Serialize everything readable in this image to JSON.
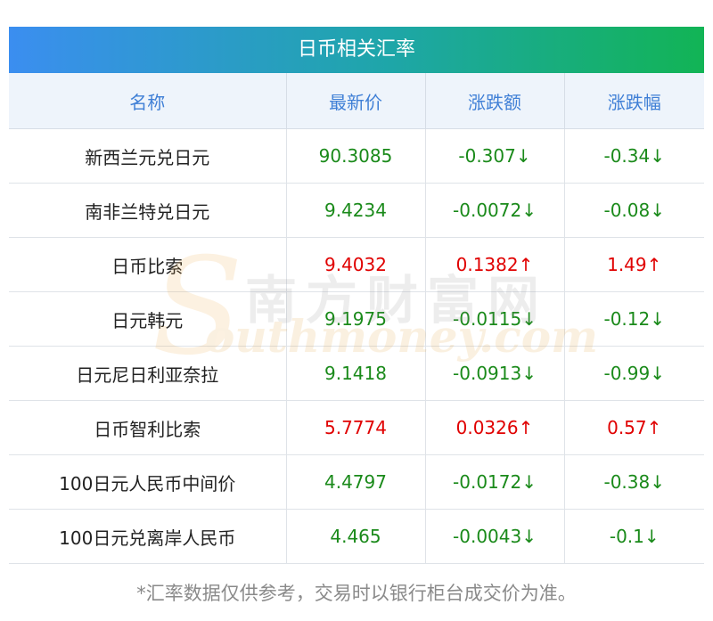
{
  "table": {
    "title": "日币相关汇率",
    "headers": [
      "名称",
      "最新价",
      "涨跌额",
      "涨跌幅"
    ],
    "rows": [
      {
        "name": "新西兰元兑日元",
        "price": "90.3085",
        "change": "-0.307↓",
        "pct": "-0.34↓",
        "dir": "down"
      },
      {
        "name": "南非兰特兑日元",
        "price": "9.4234",
        "change": "-0.0072↓",
        "pct": "-0.08↓",
        "dir": "down"
      },
      {
        "name": "日币比索",
        "price": "9.4032",
        "change": "0.1382↑",
        "pct": "1.49↑",
        "dir": "up"
      },
      {
        "name": "日元韩元",
        "price": "9.1975",
        "change": "-0.0115↓",
        "pct": "-0.12↓",
        "dir": "down"
      },
      {
        "name": "日元尼日利亚奈拉",
        "price": "9.1418",
        "change": "-0.0913↓",
        "pct": "-0.99↓",
        "dir": "down"
      },
      {
        "name": "日币智利比索",
        "price": "5.7774",
        "change": "0.0326↑",
        "pct": "0.57↑",
        "dir": "up"
      },
      {
        "name": "100日元人民币中间价",
        "price": "4.4797",
        "change": "-0.0172↓",
        "pct": "-0.38↓",
        "dir": "down"
      },
      {
        "name": "100日元兑离岸人民币",
        "price": "4.465",
        "change": "-0.0043↓",
        "pct": "-0.1↓",
        "dir": "down"
      }
    ]
  },
  "footnote": "*汇率数据仅供参考，交易时以银行柜台成交价为准。",
  "watermark": {
    "cn": "南方财富网",
    "en": "outhmoney.com",
    "s": "S"
  },
  "colors": {
    "up": "#e00000",
    "down": "#1a8a1a",
    "header_text": "#3f7fd6",
    "title_gradient_start": "#3b8ef0",
    "title_gradient_end": "#12b455"
  }
}
